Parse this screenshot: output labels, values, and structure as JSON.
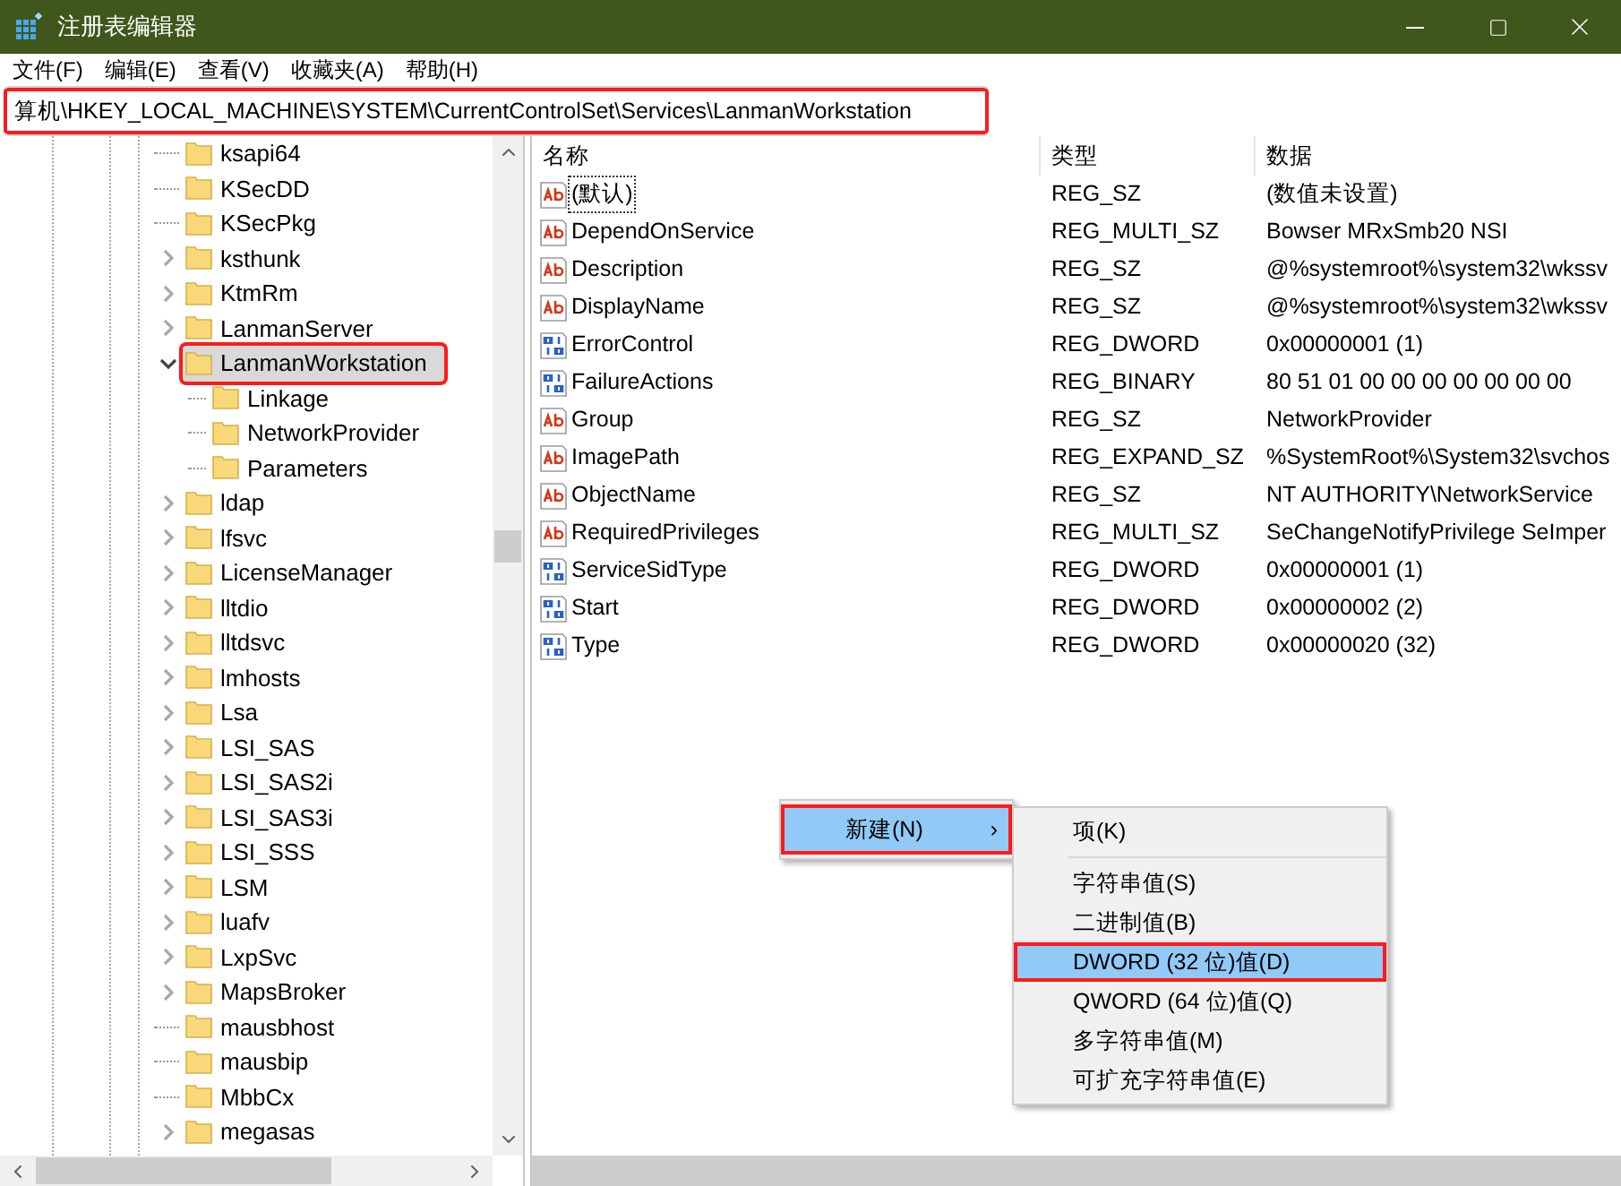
{
  "window": {
    "title": "注册表编辑器"
  },
  "menu": [
    "文件(F)",
    "编辑(E)",
    "查看(V)",
    "收藏夹(A)",
    "帮助(H)"
  ],
  "address": {
    "value": "算机\\HKEY_LOCAL_MACHINE\\SYSTEM\\CurrentControlSet\\Services\\LanmanWorkstation",
    "annotated": true
  },
  "tree": [
    {
      "label": "ksapi64",
      "expandable": false,
      "selected": false,
      "annotated": false
    },
    {
      "label": "KSecDD",
      "expandable": false,
      "selected": false,
      "annotated": false
    },
    {
      "label": "KSecPkg",
      "expandable": false,
      "selected": false,
      "annotated": false
    },
    {
      "label": "ksthunk",
      "expandable": true,
      "expanded": false,
      "selected": false,
      "annotated": false
    },
    {
      "label": "KtmRm",
      "expandable": true,
      "expanded": false,
      "selected": false,
      "annotated": false
    },
    {
      "label": "LanmanServer",
      "expandable": true,
      "expanded": false,
      "selected": false,
      "annotated": false
    },
    {
      "label": "LanmanWorkstation",
      "expandable": true,
      "expanded": true,
      "selected": true,
      "annotated": true,
      "children": [
        {
          "label": "Linkage",
          "expandable": false,
          "selected": false,
          "annotated": false
        },
        {
          "label": "NetworkProvider",
          "expandable": false,
          "selected": false,
          "annotated": false
        },
        {
          "label": "Parameters",
          "expandable": false,
          "selected": false,
          "annotated": false
        }
      ]
    },
    {
      "label": "ldap",
      "expandable": true,
      "expanded": false,
      "selected": false,
      "annotated": false
    },
    {
      "label": "lfsvc",
      "expandable": true,
      "expanded": false,
      "selected": false,
      "annotated": false
    },
    {
      "label": "LicenseManager",
      "expandable": true,
      "expanded": false,
      "selected": false,
      "annotated": false
    },
    {
      "label": "lltdio",
      "expandable": true,
      "expanded": false,
      "selected": false,
      "annotated": false
    },
    {
      "label": "lltdsvc",
      "expandable": true,
      "expanded": false,
      "selected": false,
      "annotated": false
    },
    {
      "label": "lmhosts",
      "expandable": true,
      "expanded": false,
      "selected": false,
      "annotated": false
    },
    {
      "label": "Lsa",
      "expandable": true,
      "expanded": false,
      "selected": false,
      "annotated": false
    },
    {
      "label": "LSI_SAS",
      "expandable": true,
      "expanded": false,
      "selected": false,
      "annotated": false
    },
    {
      "label": "LSI_SAS2i",
      "expandable": true,
      "expanded": false,
      "selected": false,
      "annotated": false
    },
    {
      "label": "LSI_SAS3i",
      "expandable": true,
      "expanded": false,
      "selected": false,
      "annotated": false
    },
    {
      "label": "LSI_SSS",
      "expandable": true,
      "expanded": false,
      "selected": false,
      "annotated": false
    },
    {
      "label": "LSM",
      "expandable": true,
      "expanded": false,
      "selected": false,
      "annotated": false
    },
    {
      "label": "luafv",
      "expandable": true,
      "expanded": false,
      "selected": false,
      "annotated": false
    },
    {
      "label": "LxpSvc",
      "expandable": true,
      "expanded": false,
      "selected": false,
      "annotated": false
    },
    {
      "label": "MapsBroker",
      "expandable": true,
      "expanded": false,
      "selected": false,
      "annotated": false
    },
    {
      "label": "mausbhost",
      "expandable": false,
      "selected": false,
      "annotated": false
    },
    {
      "label": "mausbip",
      "expandable": false,
      "selected": false,
      "annotated": false
    },
    {
      "label": "MbbCx",
      "expandable": false,
      "selected": false,
      "annotated": false
    },
    {
      "label": "megasas",
      "expandable": true,
      "expanded": false,
      "selected": false,
      "annotated": false
    }
  ],
  "values": {
    "columns": [
      "名称",
      "类型",
      "数据"
    ],
    "rows": [
      {
        "kind": "string",
        "name": "(默认)",
        "type": "REG_SZ",
        "data": "(数值未设置)",
        "focused": true
      },
      {
        "kind": "string",
        "name": "DependOnService",
        "type": "REG_MULTI_SZ",
        "data": "Bowser MRxSmb20 NSI",
        "focused": false
      },
      {
        "kind": "string",
        "name": "Description",
        "type": "REG_SZ",
        "data": "@%systemroot%\\system32\\wkssv",
        "focused": false
      },
      {
        "kind": "string",
        "name": "DisplayName",
        "type": "REG_SZ",
        "data": "@%systemroot%\\system32\\wkssv",
        "focused": false
      },
      {
        "kind": "binary",
        "name": "ErrorControl",
        "type": "REG_DWORD",
        "data": "0x00000001 (1)",
        "focused": false
      },
      {
        "kind": "binary",
        "name": "FailureActions",
        "type": "REG_BINARY",
        "data": "80 51 01 00 00 00 00 00 00 00",
        "focused": false
      },
      {
        "kind": "string",
        "name": "Group",
        "type": "REG_SZ",
        "data": "NetworkProvider",
        "focused": false
      },
      {
        "kind": "string",
        "name": "ImagePath",
        "type": "REG_EXPAND_SZ",
        "data": "%SystemRoot%\\System32\\svchos",
        "focused": false
      },
      {
        "kind": "string",
        "name": "ObjectName",
        "type": "REG_SZ",
        "data": "NT AUTHORITY\\NetworkService",
        "focused": false
      },
      {
        "kind": "string",
        "name": "RequiredPrivileges",
        "type": "REG_MULTI_SZ",
        "data": "SeChangeNotifyPrivilege SeImper",
        "focused": false
      },
      {
        "kind": "binary",
        "name": "ServiceSidType",
        "type": "REG_DWORD",
        "data": "0x00000001 (1)",
        "focused": false
      },
      {
        "kind": "binary",
        "name": "Start",
        "type": "REG_DWORD",
        "data": "0x00000002 (2)",
        "focused": false
      },
      {
        "kind": "binary",
        "name": "Type",
        "type": "REG_DWORD",
        "data": "0x00000020 (32)",
        "focused": false
      }
    ]
  },
  "context_menu": {
    "items": [
      {
        "label": "新建(N)",
        "arrow": "›",
        "selected": true,
        "annotated": true
      }
    ]
  },
  "submenu": {
    "items": [
      {
        "kind": "item",
        "label": "项(K)",
        "selected": false,
        "annotated": false
      },
      {
        "kind": "separator"
      },
      {
        "kind": "item",
        "label": "字符串值(S)",
        "selected": false,
        "annotated": false
      },
      {
        "kind": "item",
        "label": "二进制值(B)",
        "selected": false,
        "annotated": false
      },
      {
        "kind": "item",
        "label": "DWORD (32 位)值(D)",
        "selected": true,
        "annotated": true
      },
      {
        "kind": "item",
        "label": "QWORD (64 位)值(Q)",
        "selected": false,
        "annotated": false
      },
      {
        "kind": "item",
        "label": "多字符串值(M)",
        "selected": false,
        "annotated": false
      },
      {
        "kind": "item",
        "label": "可扩充字符串值(E)",
        "selected": false,
        "annotated": false
      }
    ]
  }
}
